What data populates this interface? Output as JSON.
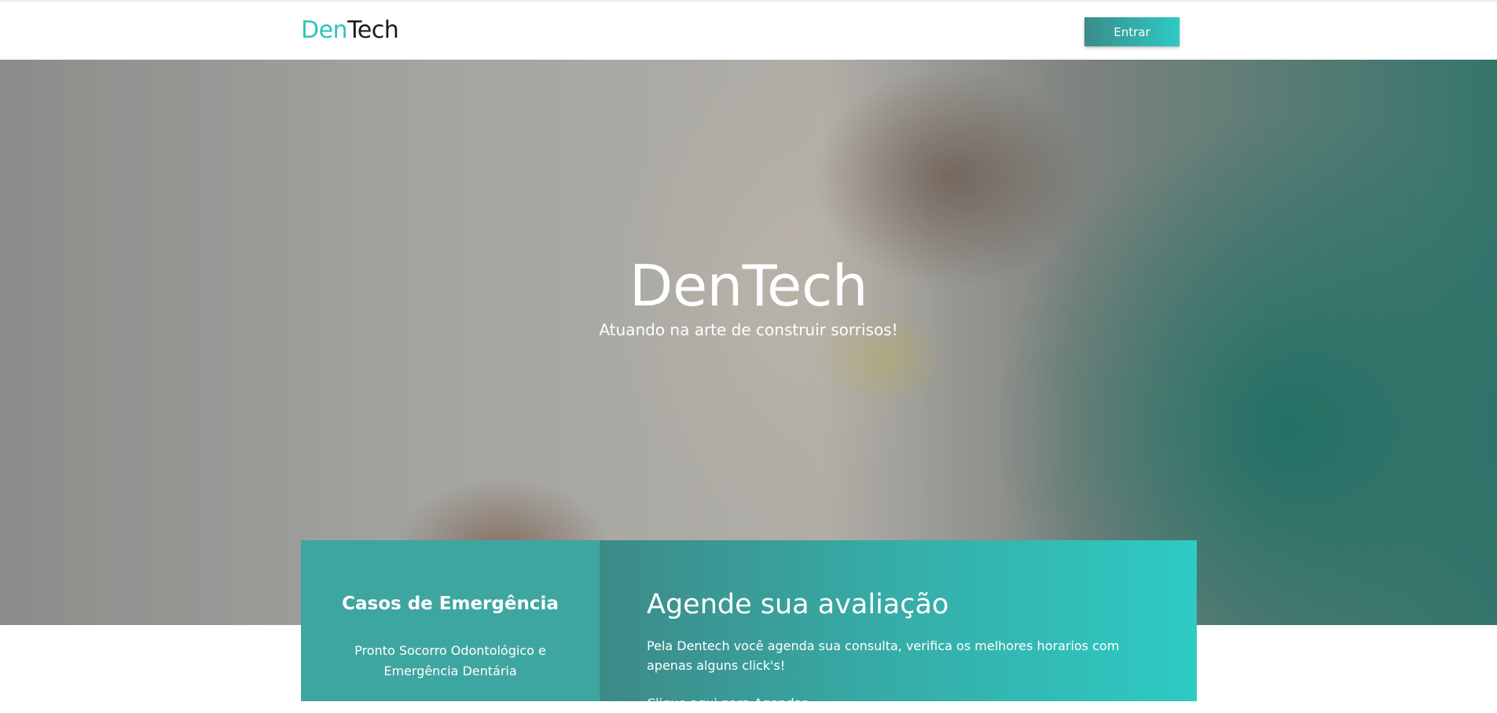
{
  "header": {
    "logo_part1": "Den",
    "logo_part2": "Tech",
    "login_label": "Entrar"
  },
  "hero": {
    "title": "DenTech",
    "subtitle": "Atuando na arte de construir sorrisos!"
  },
  "emergency": {
    "title": "Casos de Emergência",
    "text": "Pronto Socorro Odontológico e Emergência Dentária"
  },
  "schedule": {
    "title": "Agende sua avaliação",
    "text": "Pela Dentech você agenda sua consulta, verifica os melhores horarios com apenas alguns click's!",
    "link_label": "Clique aqui para Agendar"
  },
  "colors": {
    "brand_teal": "#2ec4c0",
    "panel_left": "#3ea6a1",
    "gradient_start": "#3d8a88",
    "gradient_end": "#2ecac4"
  }
}
